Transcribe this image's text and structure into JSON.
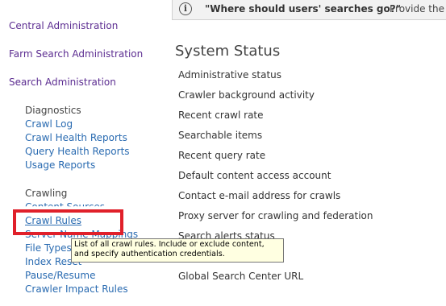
{
  "notice": {
    "icon": "info-icon",
    "bold_text": "\"Where should users' searches go?\"",
    "text": "Provide the"
  },
  "nav": {
    "central_admin": "Central Administration",
    "farm_search_admin": "Farm Search Administration",
    "search_admin": "Search Administration",
    "diagnostics": {
      "heading": "Diagnostics",
      "items": [
        "Crawl Log",
        "Crawl Health Reports",
        "Query Health Reports",
        "Usage Reports"
      ]
    },
    "crawling": {
      "heading": "Crawling",
      "items": [
        "Content Sources",
        "Crawl Rules",
        "Server Name Mappings",
        "File Types",
        "Index Reset",
        "Pause/Resume",
        "Crawler Impact Rules"
      ]
    }
  },
  "tooltip": {
    "text": "List of all crawl rules. Include or exclude content, and specify authentication credentials."
  },
  "main": {
    "title": "System Status",
    "rows": [
      "Administrative status",
      "Crawler background activity",
      "Recent crawl rate",
      "Searchable items",
      "Recent query rate",
      "Default content access account",
      "Contact e-mail address for crawls",
      "Proxy server for crawling and federation",
      "Search alerts status",
      "",
      "Global Search Center URL"
    ]
  },
  "colors": {
    "nav_link": "#5c2d91",
    "sub_link": "#2a6bb1",
    "highlight": "#e0202a",
    "tooltip_bg": "#ffffe1"
  }
}
